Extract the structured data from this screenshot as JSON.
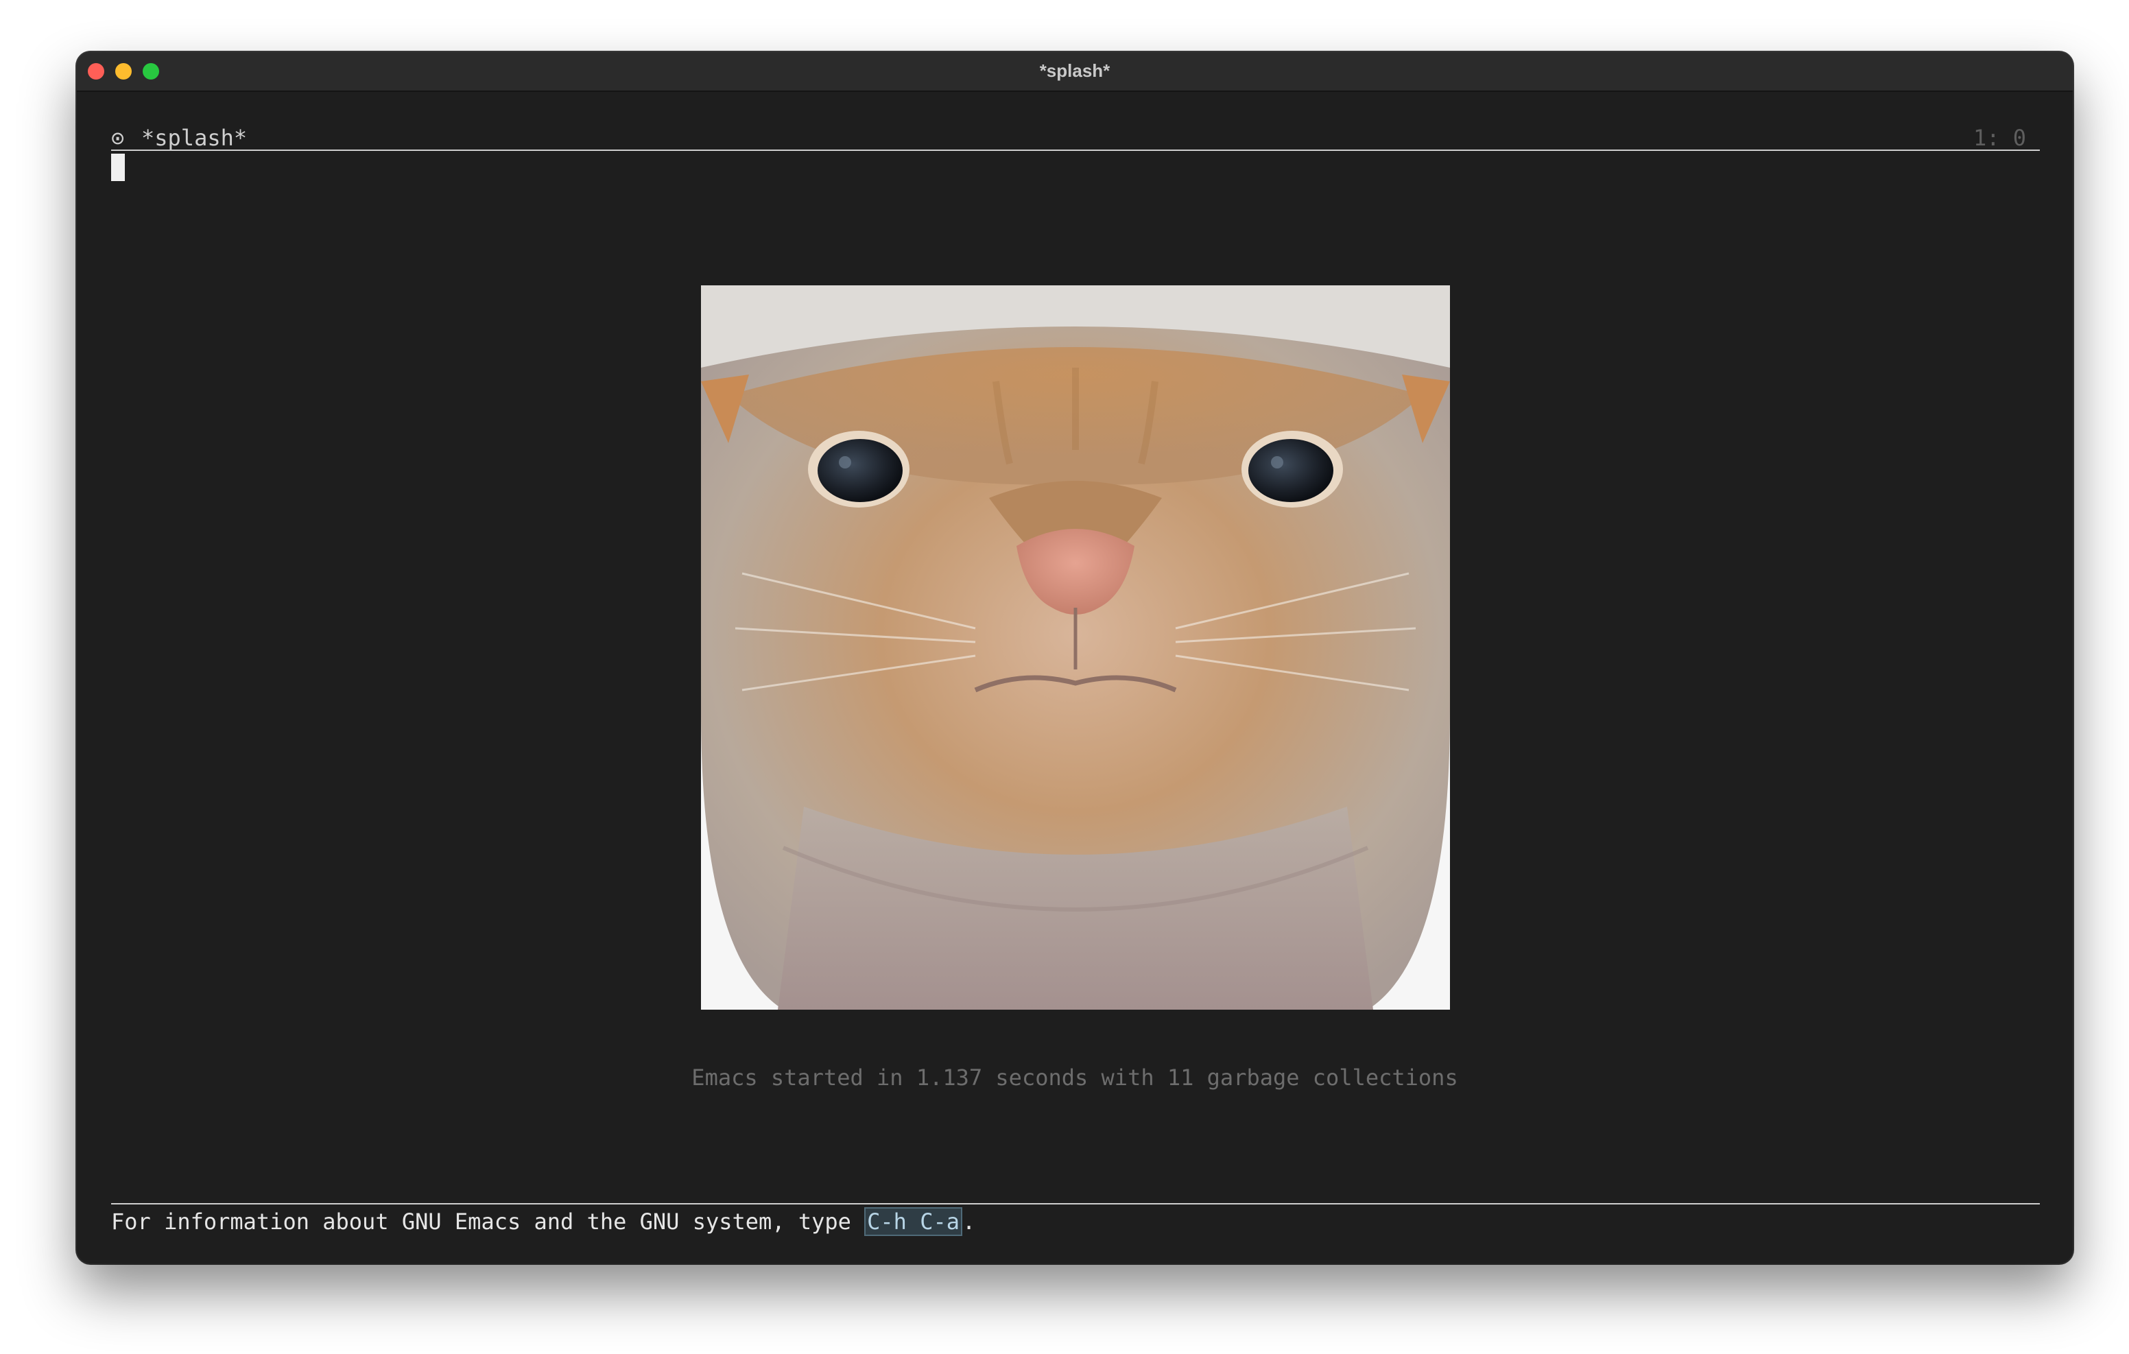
{
  "window": {
    "title": "*splash*"
  },
  "header": {
    "icon": "⊙",
    "buffer_name": "*splash*",
    "position": "1: 0"
  },
  "splash": {
    "image_description": "orange tabby cat face",
    "startup_message": "Emacs started in 1.137 seconds with 11 garbage collections"
  },
  "echo": {
    "prefix": "For information about GNU Emacs and the GNU system, type ",
    "key": "C-h C-a",
    "suffix": "."
  },
  "colors": {
    "background": "#1e1e1e",
    "foreground": "#cfcfcf",
    "muted": "#6d6d6d",
    "key_highlight": "#2f3d45"
  }
}
